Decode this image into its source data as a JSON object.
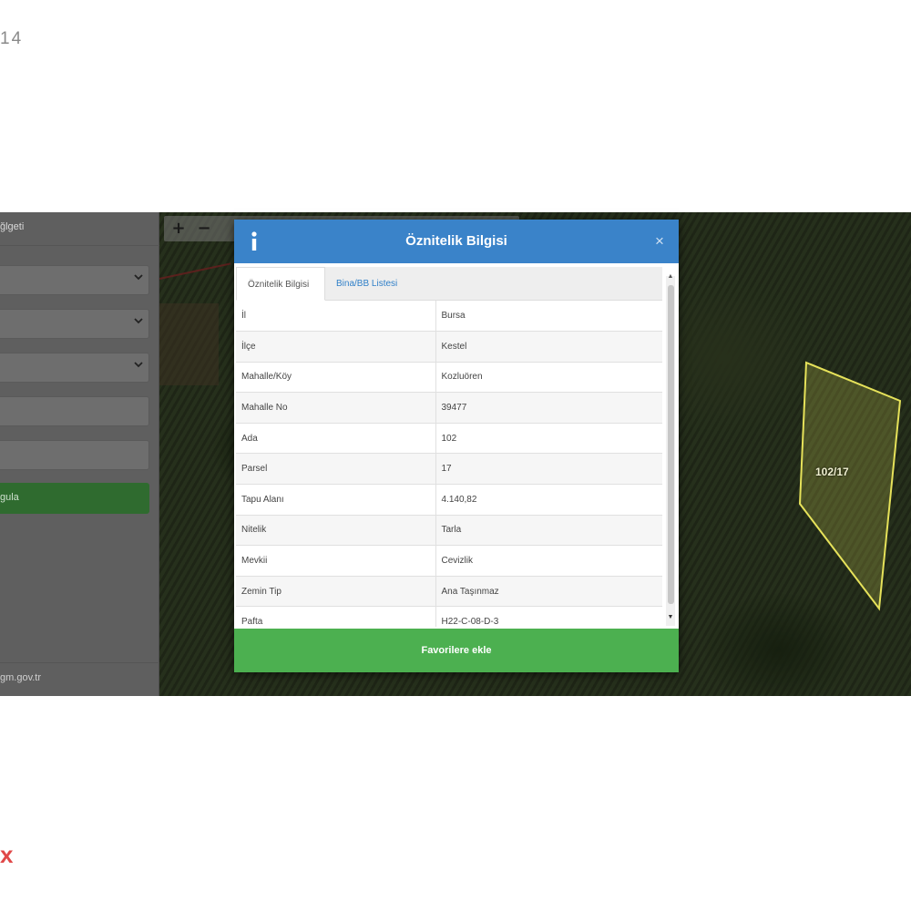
{
  "corner_number": "14",
  "corner_mark": "x",
  "sidebar": {
    "header": "ğlgeti",
    "button_label": "gula",
    "footer": "gm.gov.tr"
  },
  "map": {
    "zoom_in": "+",
    "zoom_out": "−",
    "parcel_label": "102/17"
  },
  "modal": {
    "title": "Öznitelik Bilgisi",
    "tabs": [
      {
        "label": "Öznitelik Bilgisi",
        "active": true
      },
      {
        "label": "Bina/BB Listesi",
        "active": false
      }
    ],
    "rows": [
      {
        "key": "İl",
        "value": "Bursa"
      },
      {
        "key": "İlçe",
        "value": "Kestel"
      },
      {
        "key": "Mahalle/Köy",
        "value": "Kozluören"
      },
      {
        "key": "Mahalle No",
        "value": "39477"
      },
      {
        "key": "Ada",
        "value": "102"
      },
      {
        "key": "Parsel",
        "value": "17"
      },
      {
        "key": "Tapu Alanı",
        "value": "4.140,82"
      },
      {
        "key": "Nitelik",
        "value": "Tarla"
      },
      {
        "key": "Mevkii",
        "value": "Cevizlik"
      },
      {
        "key": "Zemin Tip",
        "value": "Ana Taşınmaz"
      },
      {
        "key": "Pafta",
        "value": "H22-C-08-D-3"
      }
    ],
    "favorite_button": "Favorilere ekle"
  },
  "colors": {
    "header_blue": "#3a83c9",
    "favorite_green": "#4cb050",
    "tab_link_blue": "#2f7fc8",
    "parcel_outline": "#e6e25a"
  },
  "icons": {
    "info": "info-icon",
    "close": "close-icon",
    "chevron": "chevron-down-icon"
  }
}
